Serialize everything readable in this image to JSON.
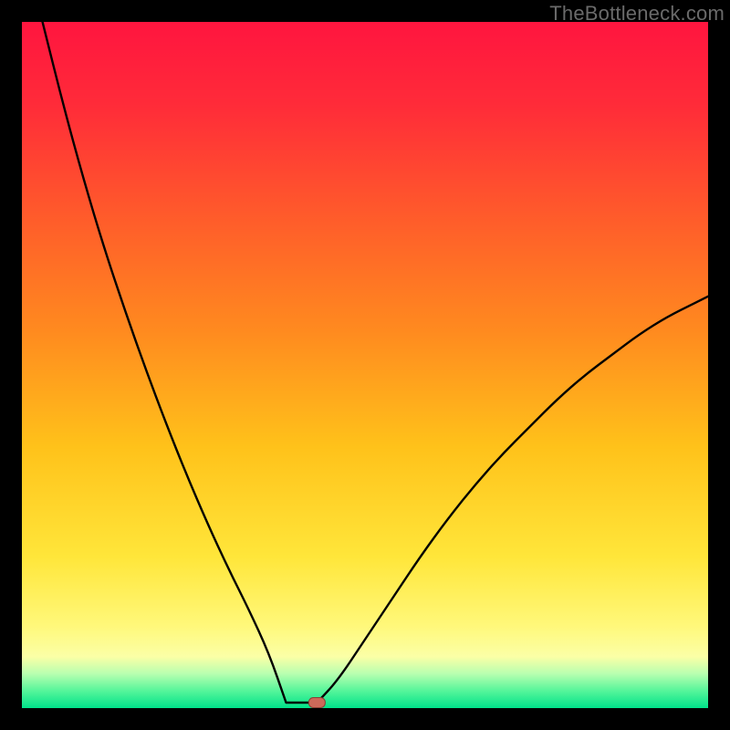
{
  "watermark": "TheBottleneck.com",
  "colors": {
    "gradient_stops": [
      {
        "offset": 0.0,
        "color": "#ff153f"
      },
      {
        "offset": 0.12,
        "color": "#ff2b39"
      },
      {
        "offset": 0.28,
        "color": "#ff5a2b"
      },
      {
        "offset": 0.45,
        "color": "#ff8a1f"
      },
      {
        "offset": 0.62,
        "color": "#ffc21a"
      },
      {
        "offset": 0.78,
        "color": "#ffe63a"
      },
      {
        "offset": 0.88,
        "color": "#fff87a"
      },
      {
        "offset": 0.925,
        "color": "#fbffa6"
      },
      {
        "offset": 0.95,
        "color": "#b8ffb0"
      },
      {
        "offset": 0.975,
        "color": "#55f59a"
      },
      {
        "offset": 1.0,
        "color": "#00e28a"
      }
    ],
    "curve": "#000000",
    "marker_fill": "#cc6a5a",
    "marker_stroke": "#8a3f35",
    "frame_bg": "#000000"
  },
  "chart_data": {
    "type": "line",
    "title": "",
    "xlabel": "",
    "ylabel": "",
    "xlim": [
      0,
      100
    ],
    "ylim": [
      0,
      100
    ],
    "grid": false,
    "legend": false,
    "flat_bottom": {
      "x_start": 38.5,
      "x_end": 43.0,
      "y": 0
    },
    "marker": {
      "x": 43.0,
      "y": 0
    },
    "series": [
      {
        "name": "left-branch",
        "x": [
          3,
          6,
          9,
          12,
          15,
          18,
          21,
          24,
          27,
          30,
          33,
          36,
          38.5
        ],
        "y": [
          100,
          88,
          77,
          67,
          58,
          49.5,
          41.5,
          34,
          27,
          20.5,
          14.5,
          8,
          1.5
        ]
      },
      {
        "name": "right-branch",
        "x": [
          43,
          46,
          50,
          54,
          58,
          62,
          66,
          70,
          74,
          78,
          82,
          86,
          90,
          94,
          98,
          100
        ],
        "y": [
          0,
          4,
          10,
          16,
          22,
          27.5,
          32.5,
          37,
          41,
          45,
          48.5,
          51.5,
          54.5,
          57,
          59,
          60
        ]
      }
    ]
  }
}
